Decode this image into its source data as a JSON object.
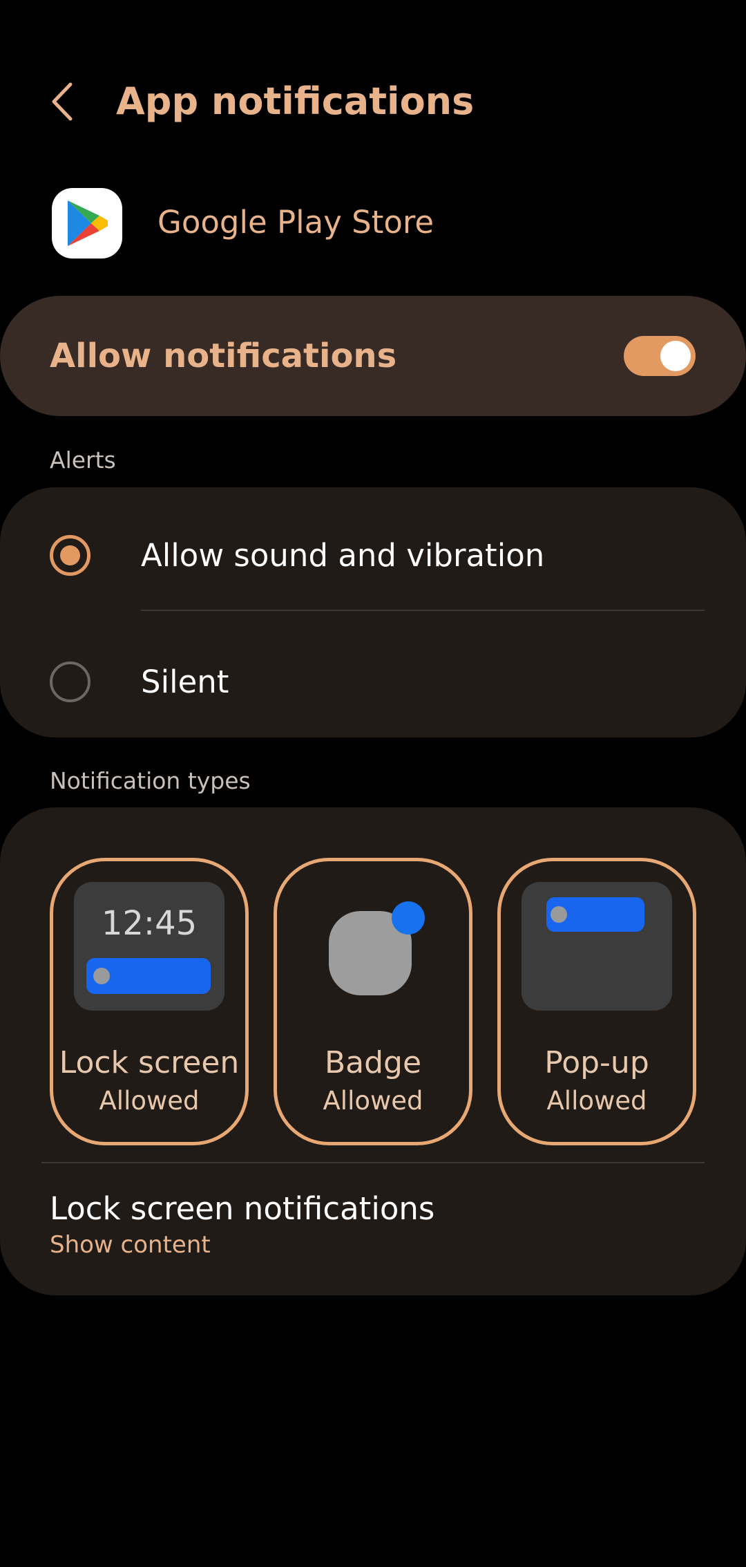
{
  "header": {
    "title": "App notifications",
    "back_icon": "chevron-left-icon"
  },
  "app": {
    "name": "Google Play Store",
    "icon": "google-play-icon"
  },
  "allow_notifications": {
    "label": "Allow notifications",
    "enabled": true
  },
  "alerts": {
    "section_label": "Alerts",
    "options": [
      {
        "label": "Allow sound and vibration",
        "selected": true
      },
      {
        "label": "Silent",
        "selected": false
      }
    ]
  },
  "notification_types": {
    "section_label": "Notification types",
    "tiles": [
      {
        "title": "Lock screen",
        "status": "Allowed",
        "preview_time": "12:45"
      },
      {
        "title": "Badge",
        "status": "Allowed"
      },
      {
        "title": "Pop-up",
        "status": "Allowed"
      }
    ],
    "lock_screen_notifications": {
      "title": "Lock screen notifications",
      "value": "Show content"
    }
  },
  "colors": {
    "accent": "#e39a62",
    "accent_text": "#e8b38a",
    "card_bg": "#211b17",
    "highlight_card_bg": "#382a25",
    "blue": "#1866f0"
  }
}
